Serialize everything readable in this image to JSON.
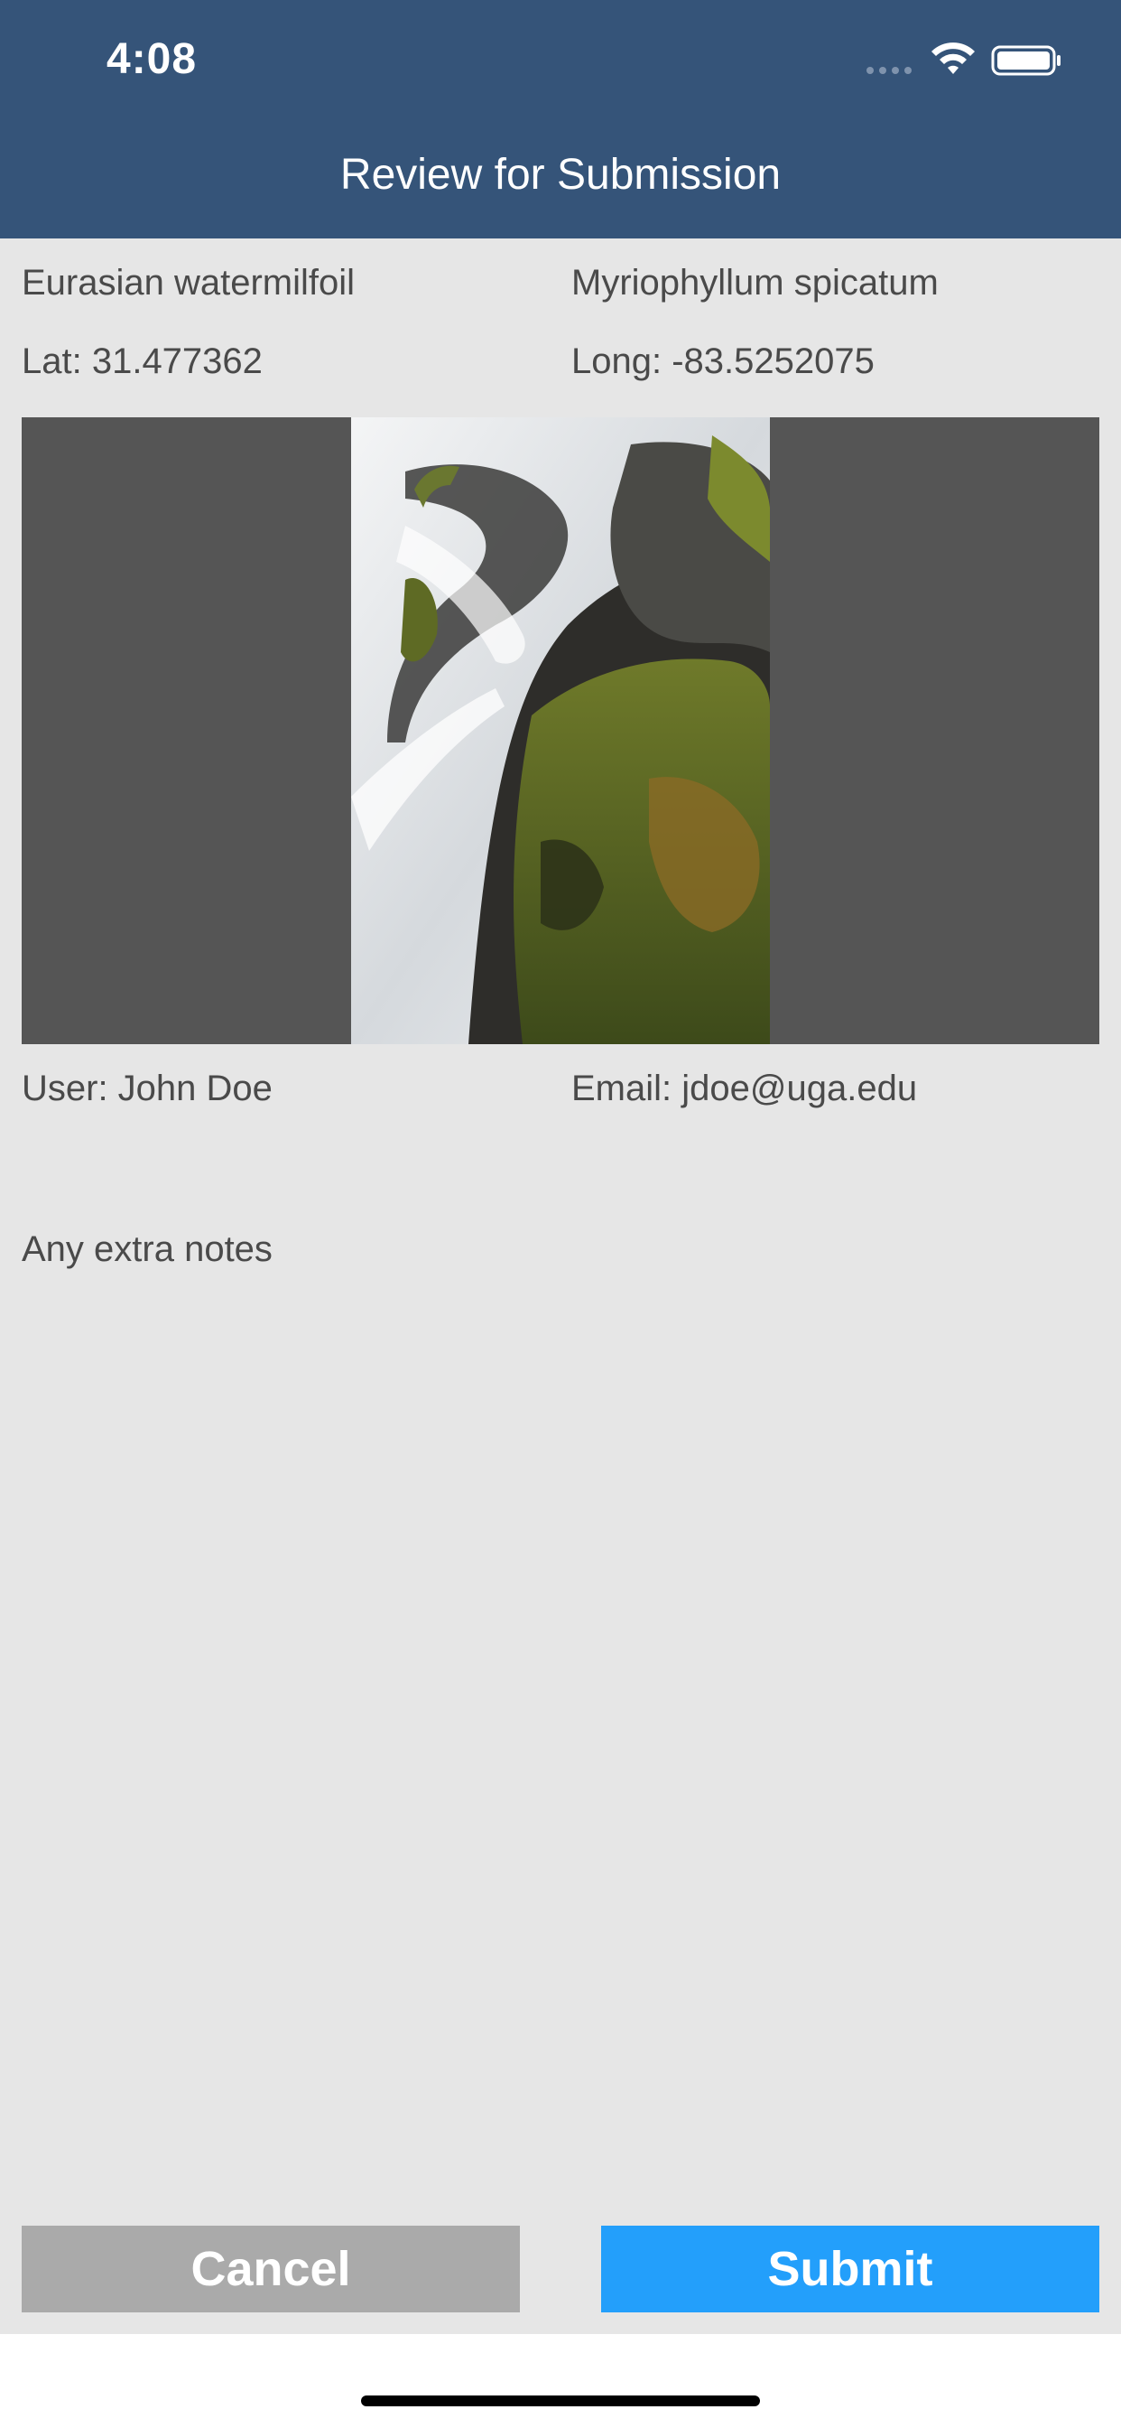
{
  "status_bar": {
    "time": "4:08"
  },
  "nav": {
    "title": "Review for Submission"
  },
  "species": {
    "common_name": "Eurasian watermilfoil",
    "scientific_name": "Myriophyllum spicatum"
  },
  "location": {
    "lat_label": "Lat: 31.477362",
    "long_label": "Long: -83.5252075"
  },
  "photo": {
    "subject": "waterfall-over-mossy-rocks"
  },
  "submitter": {
    "user_label": "User: John Doe",
    "email_label": "Email: jdoe@uga.edu"
  },
  "notes": {
    "text": "Any extra notes"
  },
  "actions": {
    "cancel_label": "Cancel",
    "submit_label": "Submit"
  },
  "colors": {
    "header_bg": "#355479",
    "page_bg": "#e6e6e6",
    "cancel_bg": "#aaaaaa",
    "submit_bg": "#239ffb"
  }
}
